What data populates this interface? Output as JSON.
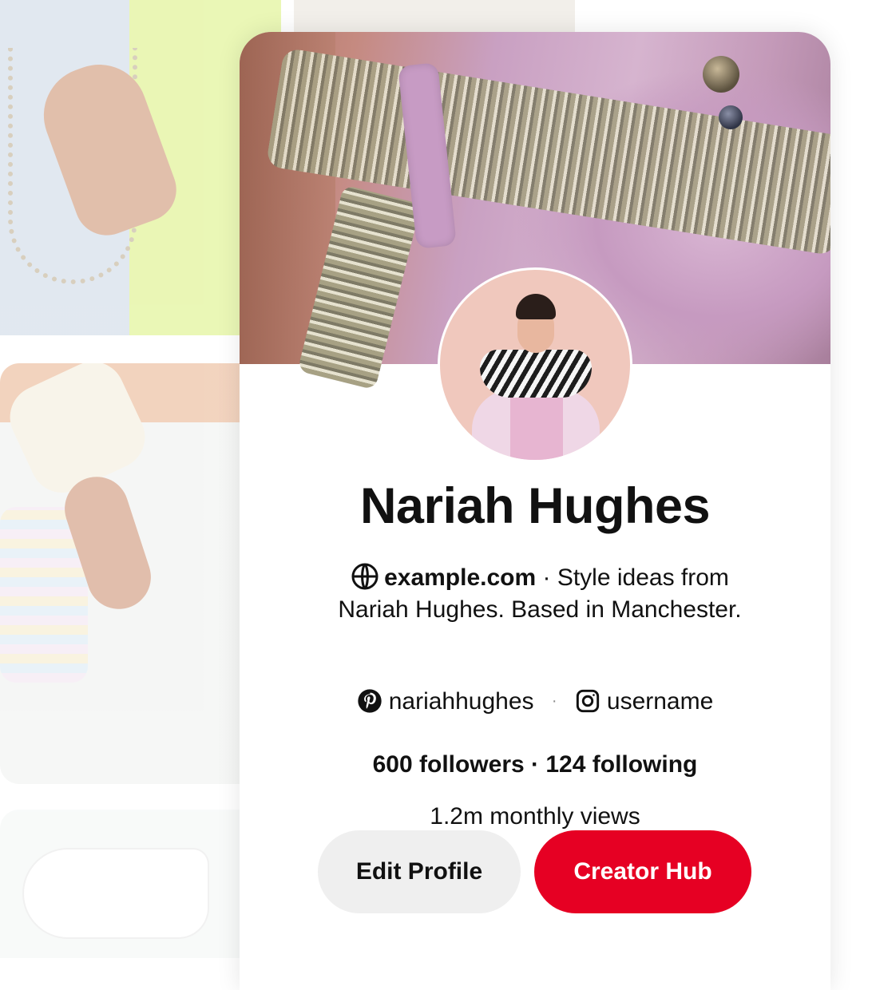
{
  "profile": {
    "name": "Nariah Hughes",
    "website": "example.com",
    "bio_line_1": " · Style ideas from",
    "bio_line_2": "Nariah Hughes. Based in Manchester.",
    "pinterest_handle": "nariahhughes",
    "separator": "·",
    "instagram_handle": "username",
    "followers_label": "600 followers",
    "stats_separator": " · ",
    "following_label": "124 following",
    "monthly_views": "1.2m monthly views"
  },
  "actions": {
    "edit_profile": "Edit Profile",
    "creator_hub": "Creator Hub"
  },
  "icons": {
    "website": "globe-icon",
    "pinterest": "pinterest-icon",
    "instagram": "instagram-icon"
  },
  "colors": {
    "primary_button": "#e60023",
    "secondary_button": "#efefef",
    "text": "#111111"
  }
}
